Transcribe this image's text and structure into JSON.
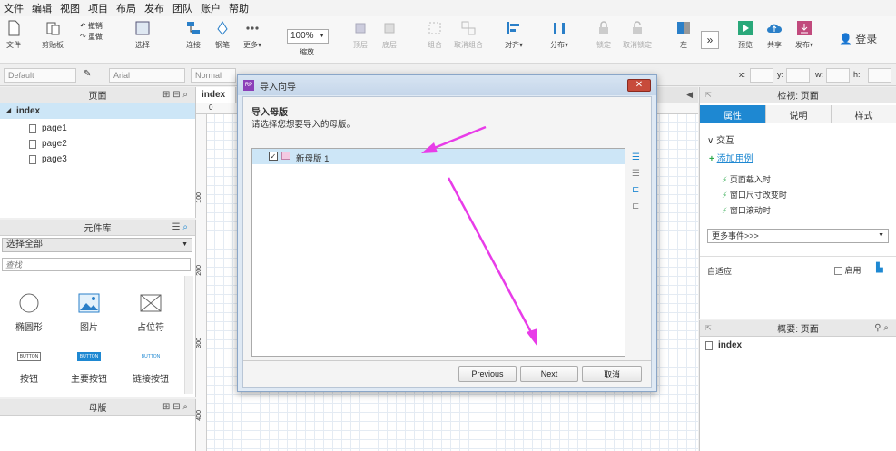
{
  "menu": [
    "文件",
    "编辑",
    "视图",
    "项目",
    "布局",
    "发布",
    "团队",
    "账户",
    "帮助"
  ],
  "toolbar": {
    "file": "文件",
    "clipboard": "剪贴板",
    "undo": "撤销",
    "redo": "重做",
    "select": "选择",
    "connect": "连接",
    "pen": "钢笔",
    "more": "更多▾",
    "zoom": "100%",
    "zoom_label": "缩放",
    "top": "顶层",
    "bottom": "底层",
    "group": "组合",
    "ungroup": "取消组合",
    "align": "对齐▾",
    "distribute": "分布▾",
    "lock": "锁定",
    "unlock": "取消锁定",
    "left": "左",
    "preview": "预览",
    "share": "共享",
    "publish": "发布▾",
    "login": "登录"
  },
  "format": {
    "style": "Default",
    "font": "Arial",
    "weight": "Normal",
    "x": "x:",
    "y": "y:",
    "w": "w:",
    "h": "h:"
  },
  "pages_panel": {
    "title": "页面",
    "root": "index",
    "children": [
      "page1",
      "page2",
      "page3"
    ]
  },
  "library_panel": {
    "title": "元件库",
    "select": "选择全部",
    "search_placeholder": "查找",
    "widgets": [
      {
        "icon": "ellipse-icon",
        "label": "椭圆形"
      },
      {
        "icon": "image-icon",
        "label": "图片"
      },
      {
        "icon": "placeholder-icon",
        "label": "占位符"
      },
      {
        "icon": "button-icon",
        "label": "按钮",
        "thumb": "BUTTON"
      },
      {
        "icon": "primary-button-icon",
        "label": "主要按钮",
        "thumb": "BUTTON"
      },
      {
        "icon": "link-button-icon",
        "label": "链接按钮",
        "thumb": "BUTTON"
      }
    ]
  },
  "masters_panel": {
    "title": "母版"
  },
  "canvas": {
    "tab": "index",
    "ruler_top": "0",
    "ruler_left": [
      "100",
      "200",
      "300",
      "400"
    ]
  },
  "dialog": {
    "title": "导入向导",
    "heading": "导入母版",
    "subtitle": "请选择您想要导入的母版。",
    "items": [
      {
        "label": "新母版 1",
        "checked": true
      }
    ],
    "buttons": {
      "previous": "Previous",
      "next": "Next",
      "cancel": "取消"
    }
  },
  "inspector": {
    "title": "检视: 页面",
    "tabs": [
      "属性",
      "说明",
      "样式"
    ],
    "section": "交互",
    "add_case": "添加用例",
    "events": [
      "页面载入时",
      "窗口尺寸改变时",
      "窗口滚动时"
    ],
    "more_events": "更多事件>>>",
    "adaptive": "自适应",
    "enable": "启用"
  },
  "outline": {
    "title": "概要: 页面",
    "root": "index"
  },
  "colors": {
    "accent": "#1e88d2",
    "arrow": "#e83ce8",
    "selected_row": "#cde6f7"
  }
}
